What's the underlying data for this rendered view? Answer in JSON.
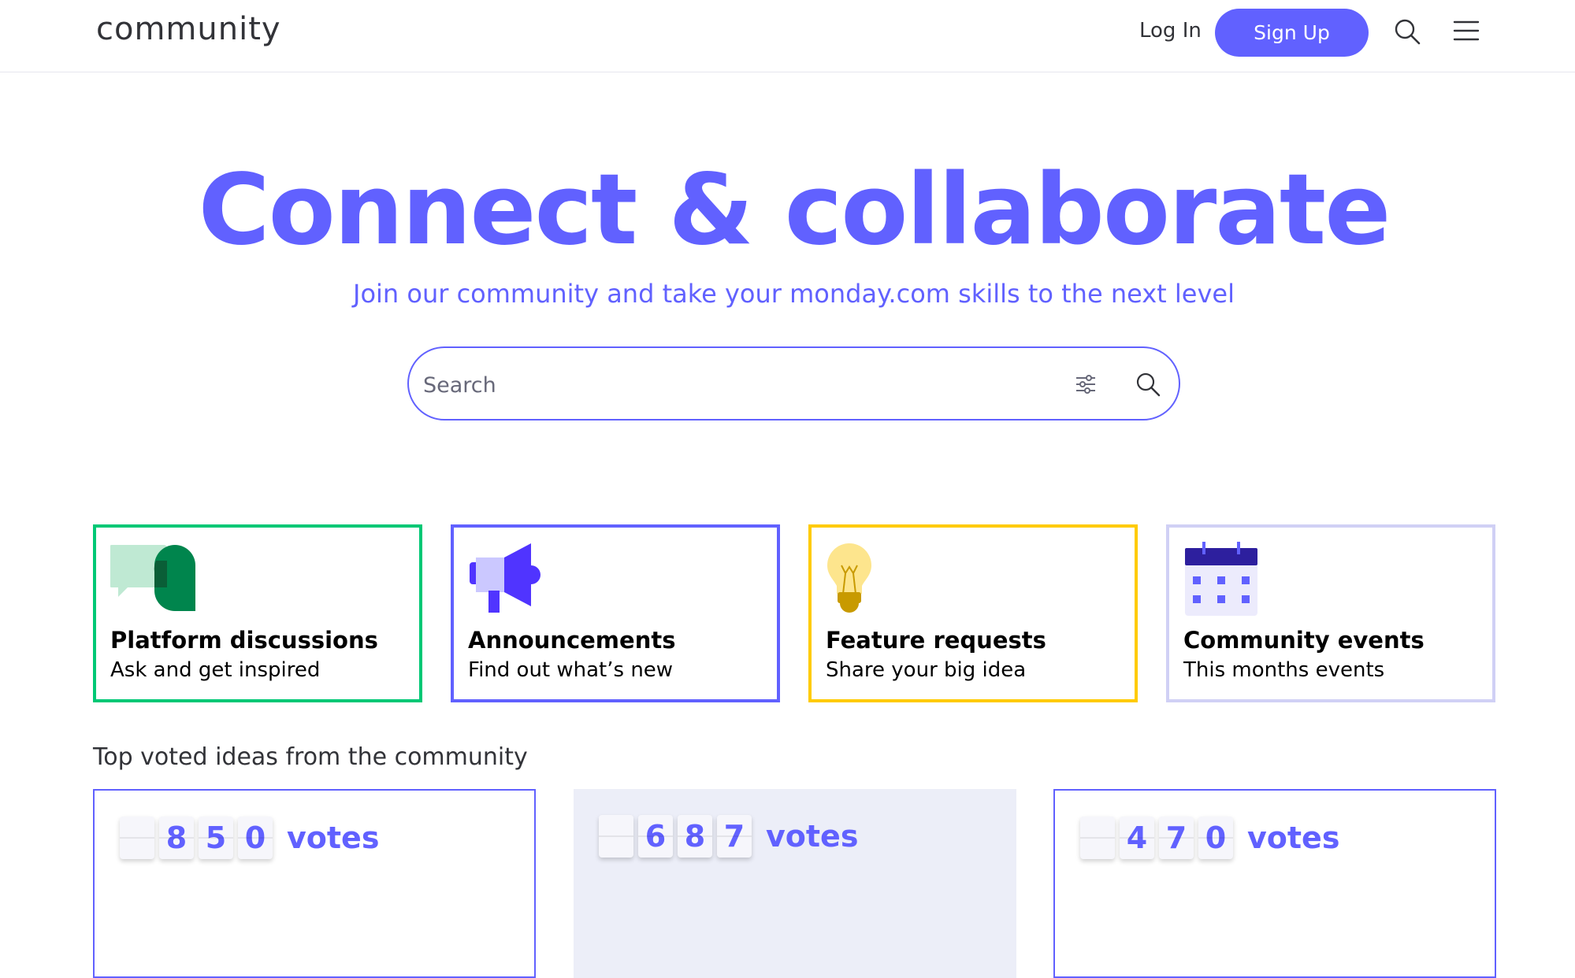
{
  "header": {
    "logo": "community",
    "login_label": "Log In",
    "signup_label": "Sign Up",
    "search_icon": "search-icon",
    "menu_icon": "hamburger-menu-icon"
  },
  "hero": {
    "title": "Connect & collaborate",
    "subtitle": "Join our community and take your monday.com skills to the next level",
    "search_placeholder": "Search"
  },
  "categories": [
    {
      "title": "Platform discussions",
      "subtitle": "Ask and get inspired",
      "icon": "chat-bubbles-icon",
      "border_color": "#00c875"
    },
    {
      "title": "Announcements",
      "subtitle": "Find out what’s new",
      "icon": "megaphone-icon",
      "border_color": "#6161ff"
    },
    {
      "title": "Feature requests",
      "subtitle": "Share your big idea",
      "icon": "lightbulb-icon",
      "border_color": "#ffcb00"
    },
    {
      "title": "Community events",
      "subtitle": "This months events",
      "icon": "calendar-icon",
      "border_color": "#d0d0f5"
    }
  ],
  "top_ideas": {
    "title": "Top voted ideas from the community",
    "items": [
      {
        "digits": [
          "",
          "8",
          "5",
          "0"
        ],
        "label": "votes"
      },
      {
        "digits": [
          "",
          "6",
          "8",
          "7"
        ],
        "label": "votes"
      },
      {
        "digits": [
          "",
          "4",
          "7",
          "0"
        ],
        "label": "votes"
      }
    ]
  },
  "colors": {
    "accent": "#6161ff",
    "green": "#00c875",
    "yellow": "#ffcb00",
    "lavender": "#d0d0f5"
  }
}
